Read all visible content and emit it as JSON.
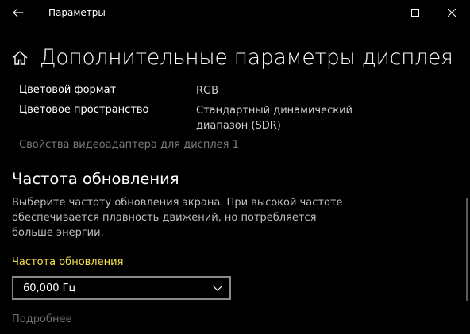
{
  "window": {
    "app_title": "Параметры",
    "back_icon": "arrow-left-icon",
    "minimize_icon": "minimize-icon",
    "maximize_icon": "maximize-icon",
    "close_icon": "close-icon"
  },
  "header": {
    "home_icon": "home-icon",
    "title": "Дополнительные параметры дисплея"
  },
  "display_info": {
    "items": [
      {
        "label": "Цветовой формат",
        "value": "RGB"
      },
      {
        "label": "Цветовое пространство",
        "value": "Стандартный динамический диапазон (SDR)"
      }
    ],
    "adapter_link": "Свойства видеоадаптера для дисплея 1"
  },
  "refresh": {
    "section_title": "Частота обновления",
    "description": "Выберите частоту обновления экрана. При высокой частоте обеспечивается плавность движений, но потребляется больше энергии.",
    "field_label": "Частота обновления",
    "selected_value": "60,000 Гц",
    "chevron_icon": "chevron-down-icon",
    "learn_more": "Подробнее"
  },
  "colors": {
    "background": "#000000",
    "text": "#ffffff",
    "accent_label": "#f5e04a",
    "muted": "#7a7a7a",
    "border": "#8a8a8a"
  }
}
